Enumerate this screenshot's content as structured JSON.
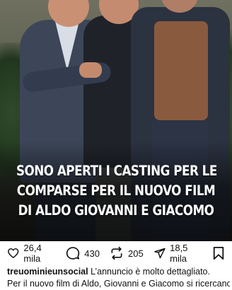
{
  "post": {
    "headline_lines": [
      "SONO APERTI I CASTING PER LE",
      "COMPARSE PER IL NUOVO FILM",
      "DI ALDO GIOVANNI E GIACOMO"
    ]
  },
  "actions": {
    "like": {
      "icon": "heart-icon",
      "count": "26,4 mila"
    },
    "comment": {
      "icon": "comment-icon",
      "count": "430"
    },
    "repost": {
      "icon": "repost-icon",
      "count": "205"
    },
    "share": {
      "icon": "send-icon",
      "count": "18,5 mila"
    },
    "save": {
      "icon": "bookmark-icon"
    }
  },
  "caption": {
    "username": "treuominiеunsocial",
    "text_line1": "L’annuncio è molto dettagliato.",
    "text_line2": "Per il nuovo film di Aldo, Giovanni e Giacomo si ricercano"
  }
}
